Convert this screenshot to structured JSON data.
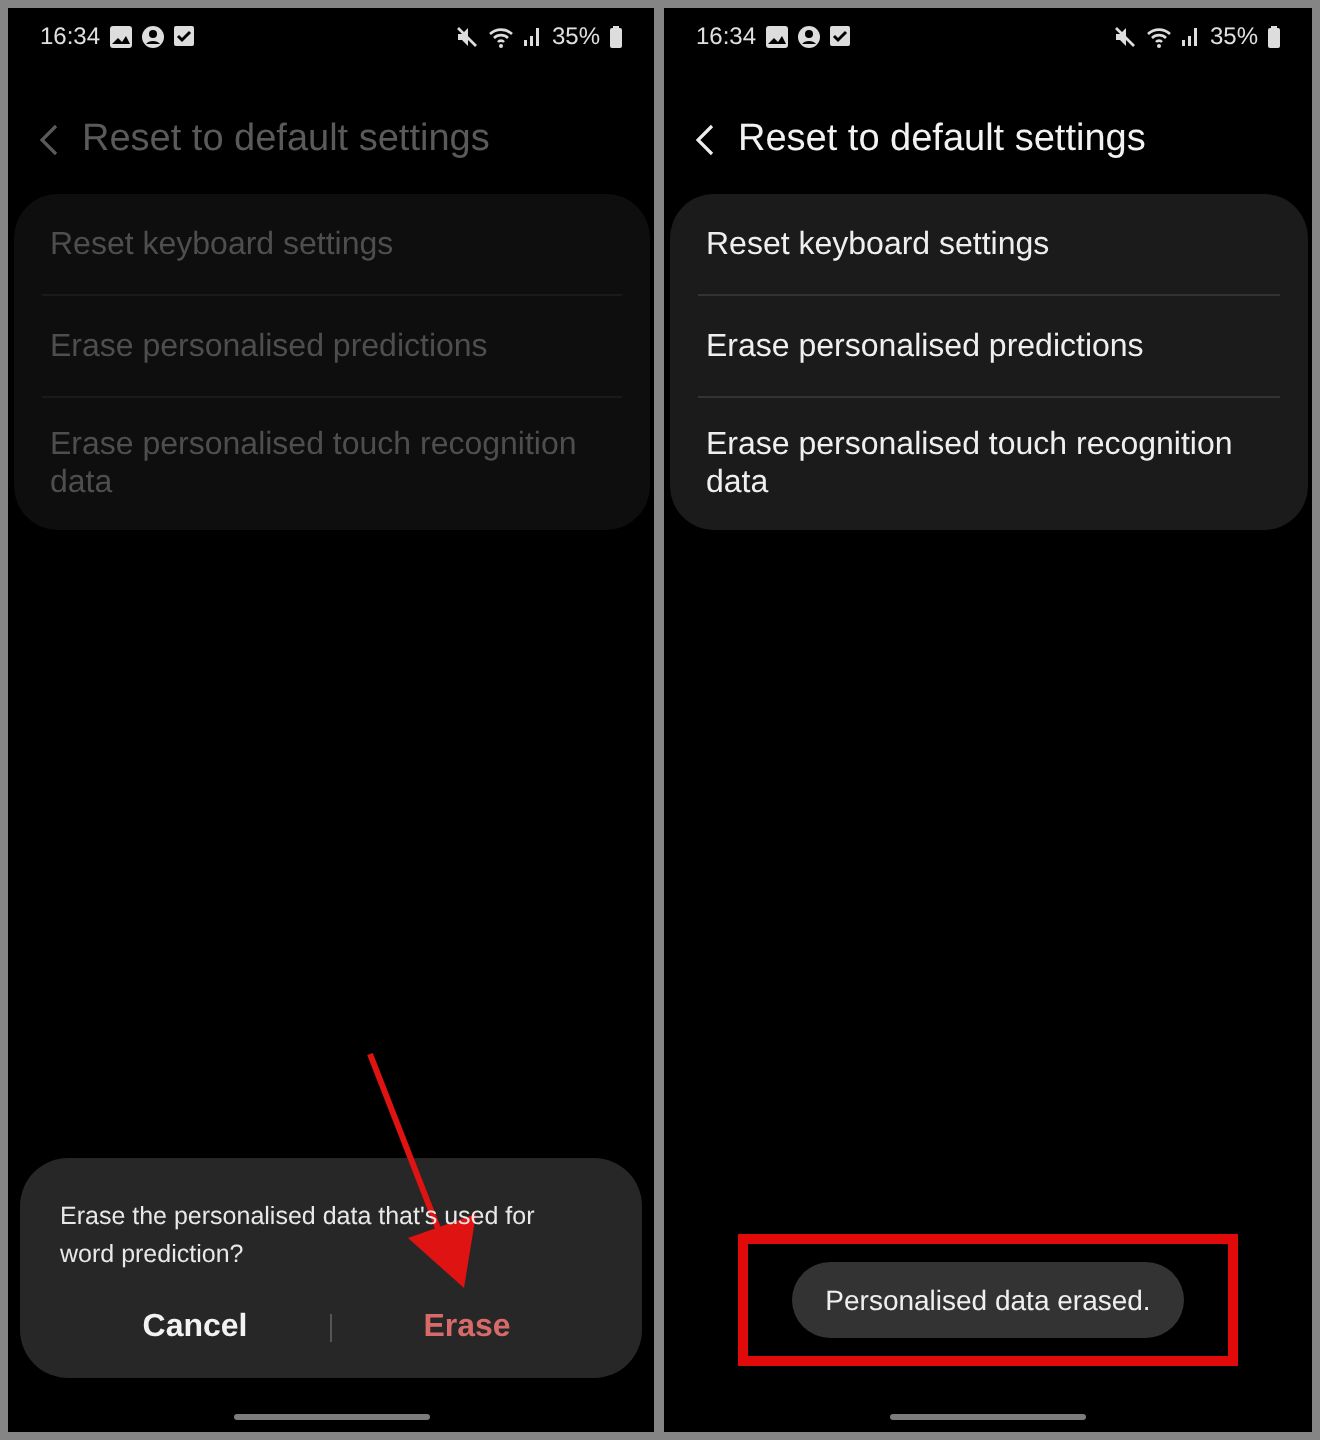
{
  "screens": [
    {
      "status_bar": {
        "time": "16:34",
        "battery": "35%"
      },
      "header": {
        "title": "Reset to default settings"
      },
      "dimmed": true,
      "items": [
        {
          "label": "Reset keyboard settings"
        },
        {
          "label": "Erase personalised predictions"
        },
        {
          "label": "Erase personalised touch recognition data"
        }
      ],
      "dialog": {
        "message": "Erase the personalised data that's used for word prediction?",
        "buttons": [
          {
            "label": "Cancel",
            "kind": "neutral"
          },
          {
            "label": "Erase",
            "kind": "destructive"
          }
        ]
      },
      "annotation": {
        "kind": "arrow"
      }
    },
    {
      "status_bar": {
        "time": "16:34",
        "battery": "35%"
      },
      "header": {
        "title": "Reset to default settings"
      },
      "dimmed": false,
      "items": [
        {
          "label": "Reset keyboard settings"
        },
        {
          "label": "Erase personalised predictions"
        },
        {
          "label": "Erase personalised touch recognition data"
        }
      ],
      "toast": {
        "text": "Personalised data erased."
      },
      "annotation": {
        "kind": "highlight-box"
      }
    }
  ]
}
